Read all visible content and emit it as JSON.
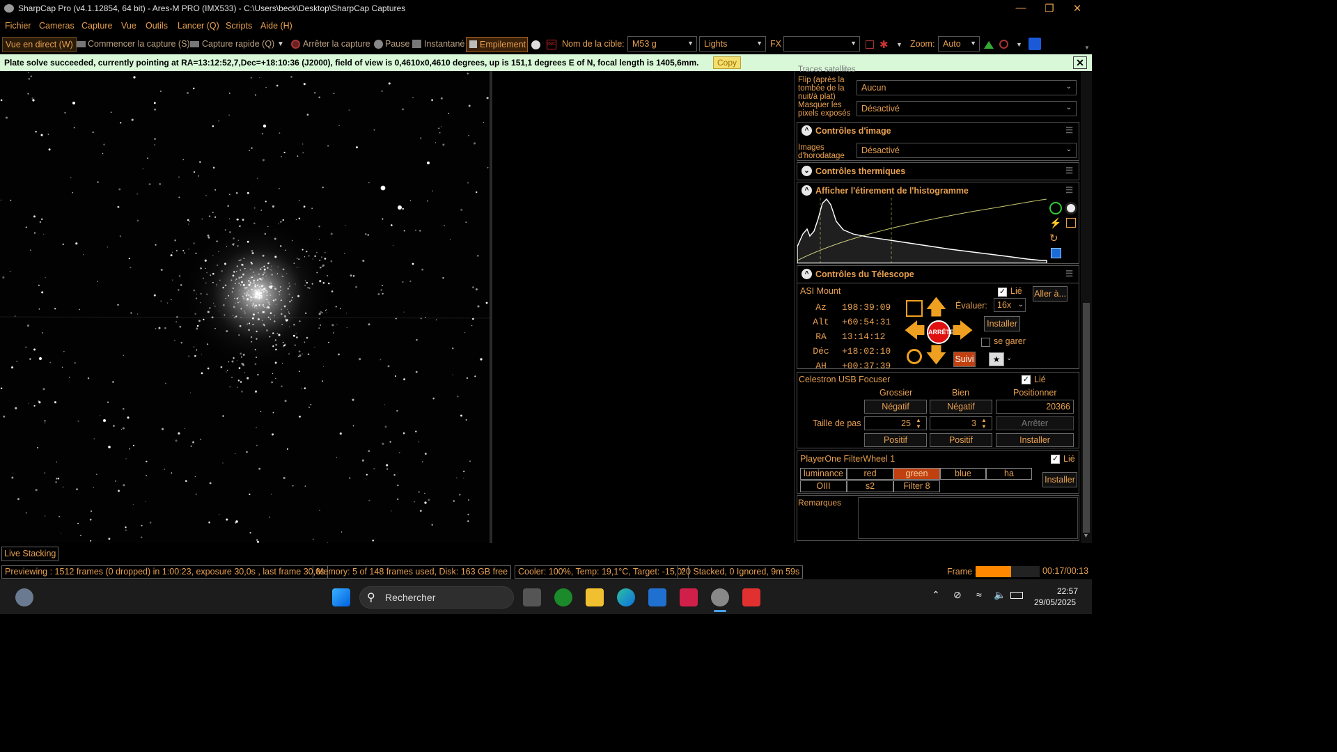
{
  "window": {
    "title": "SharpCap Pro (v4.1.12854, 64 bit) - Ares-M PRO (IMX533) - C:\\Users\\beck\\Desktop\\SharpCap Captures"
  },
  "menu": [
    "Fichier",
    "Cameras",
    "Capture",
    "Vue",
    "Outils",
    "Lancer (Q)",
    "Scripts",
    "Aide (H)"
  ],
  "toolbar": {
    "live_view": "Vue en direct (W)",
    "start_capture": "Commencer la capture (S)",
    "quick_capture": "Capture rapide (Q)",
    "stop_capture": "Arrêter la capture",
    "pause": "Pause",
    "snapshot": "Instantané",
    "stacking": "Empilement",
    "target_label": "Nom de la cible:",
    "target_value": "M53 g",
    "frame_type": "Lights",
    "fx_label": "FX",
    "fx_value": "",
    "zoom_label": "Zoom:",
    "zoom_value": "Auto"
  },
  "notice": {
    "message": "Plate solve succeeded, currently pointing at RA=13:12:52,7,Dec=+18:10:36 (J2000), field of view is 0,4610x0,4610 degrees, up is 151,1 degrees E of N, focal length is 1405,6mm.",
    "copy": "Copy",
    "close": "✕"
  },
  "panel": {
    "cut_label": "Traces satellites",
    "flip_label": "Flip (après la tombée de la nuit/à plat)",
    "flip_value": "Aucun",
    "mask_label": "Masquer les pixels exposés",
    "mask_value": "Désactivé",
    "image_controls": {
      "title": "Contrôles d'image",
      "timestamp_label": "Images d'horodatage",
      "timestamp_value": "Désactivé"
    },
    "thermal": {
      "title": "Contrôles thermiques"
    },
    "histogram": {
      "title": "Afficher l'étirement de l'histogramme"
    },
    "telescope": {
      "title": "Contrôles du Télescope",
      "mount": "ASI Mount",
      "linked": "Lié",
      "goto": "Aller à...",
      "coords": [
        {
          "k": "Az",
          "v": "198:39:09"
        },
        {
          "k": "Alt",
          "v": "+60:54:31"
        },
        {
          "k": "RA",
          "v": "13:14:12"
        },
        {
          "k": "Déc",
          "v": "+18:02:10"
        },
        {
          "k": "AH",
          "v": "+00:37:39"
        }
      ],
      "rate_label": "Évaluer:",
      "rate_value": "16x",
      "install": "Installer",
      "stop": "ARRÊTE",
      "park": "se garer",
      "track": "Suivi"
    },
    "focuser": {
      "name": "Celestron USB Focuser",
      "linked": "Lié",
      "coarse": "Grossier",
      "fine": "Bien",
      "position": "Positionner",
      "negative": "Négatif",
      "position_value": "20366",
      "step_label": "Taille de pas",
      "coarse_step": "25",
      "fine_step": "3",
      "stop": "Arrêter",
      "positive": "Positif",
      "install": "Installer"
    },
    "filterwheel": {
      "name": "PlayerOne FilterWheel 1",
      "linked": "Lié",
      "filters": [
        "luminance",
        "red",
        "green",
        "blue",
        "ha",
        "OIII",
        "s2",
        "Filter 8"
      ],
      "active": "green",
      "install": "Installer"
    },
    "notes_label": "Remarques"
  },
  "bottom": {
    "live_stacking": "Live Stacking",
    "preview": "Previewing : 1512 frames (0 dropped) in 1:00:23, exposure 30,0s , last frame 30,0s",
    "memory": "Memory: 5 of 148 frames used, Disk: 163 GB free",
    "cooler": "Cooler: 100%, Temp: 19,1°C, Target: -15,0°",
    "stacked": "20 Stacked, 0 Ignored, 9m 59s",
    "frame_label": "Frame :",
    "frame_time": "00:17/00:13",
    "frame_progress": 0.55
  },
  "taskbar": {
    "search": "Rechercher",
    "time": "22:57",
    "date": "29/05/2025"
  },
  "colors": {
    "accent": "#e8a050",
    "notice_bg": "#d8f8d8",
    "active_filter": "#c04010",
    "progress": "#ff8800"
  }
}
